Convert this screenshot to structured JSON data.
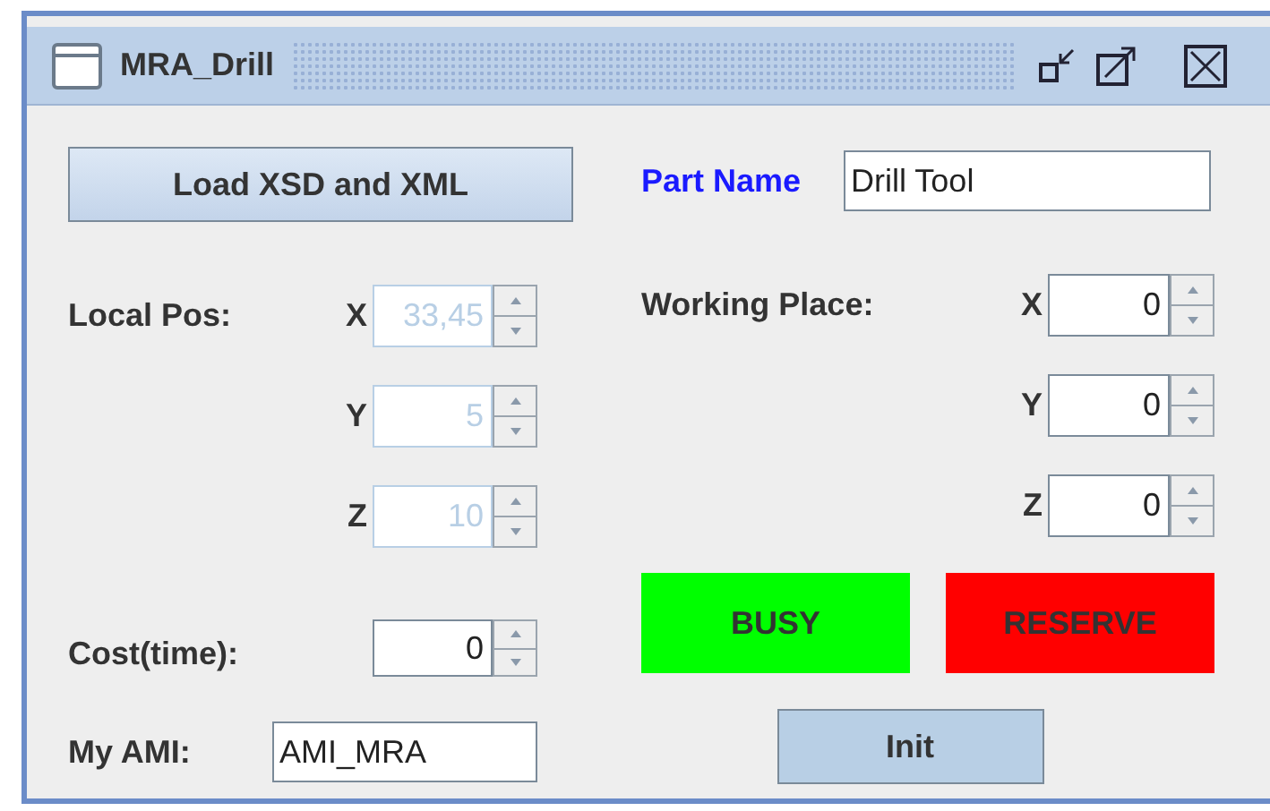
{
  "window": {
    "title": "MRA_Drill"
  },
  "load_button": "Load XSD and XML",
  "part_name": {
    "label": "Part Name",
    "value": "Drill Tool"
  },
  "local_pos": {
    "label": "Local Pos:",
    "axes": [
      {
        "axis": "X",
        "value": "33,45",
        "disabled": true
      },
      {
        "axis": "Y",
        "value": "5",
        "disabled": true
      },
      {
        "axis": "Z",
        "value": "10",
        "disabled": true
      }
    ]
  },
  "working_place": {
    "label": "Working Place:",
    "axes": [
      {
        "axis": "X",
        "value": "0",
        "disabled": false
      },
      {
        "axis": "Y",
        "value": "0",
        "disabled": false
      },
      {
        "axis": "Z",
        "value": "0",
        "disabled": false
      }
    ]
  },
  "cost": {
    "label": "Cost(time):",
    "value": "0"
  },
  "my_ami": {
    "label": "My AMI:",
    "value": "AMI_MRA"
  },
  "status_buttons": [
    {
      "label": "BUSY",
      "color": "#00ff00"
    },
    {
      "label": "RESERVE",
      "color": "#ff0000"
    }
  ],
  "init_button": "Init"
}
